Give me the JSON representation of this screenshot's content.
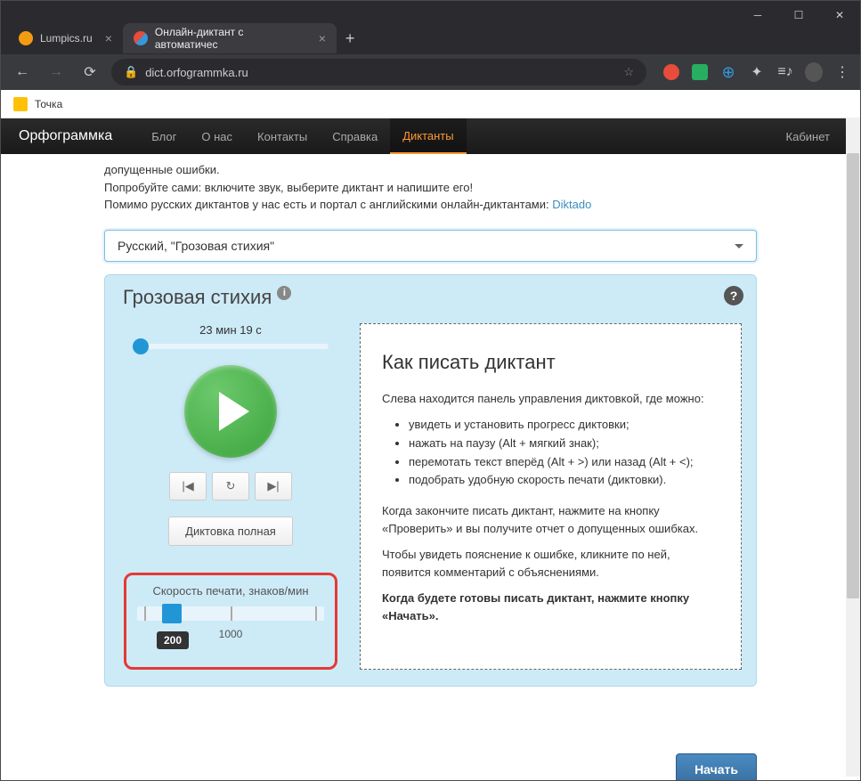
{
  "window": {
    "tabs": [
      {
        "title": "Lumpics.ru",
        "favicon_color": "#f39c12"
      },
      {
        "title": "Онлайн-диктант с автоматичес",
        "favicon_color": "#e74c3c"
      }
    ],
    "url_host": "dict.orfogrammka.ru",
    "bookmark": "Точка"
  },
  "site_nav": {
    "logo": "Орфограммка",
    "items": [
      "Блог",
      "О нас",
      "Контакты",
      "Справка",
      "Диктанты"
    ],
    "active_index": 4,
    "right": "Кабинет"
  },
  "intro": {
    "line0_cut": "допущенные ошибки.",
    "line1": "Попробуйте сами: включите звук, выберите диктант и напишите его!",
    "line2_pre": "Помимо русских диктантов у нас есть и портал с английскими онлайн-диктантами: ",
    "link": "Diktado"
  },
  "select_value": "Русский, \"Грозовая стихия\"",
  "panel": {
    "title": "Грозовая стихия",
    "duration": "23 мин 19 с",
    "mode_button": "Диктовка полная",
    "speed": {
      "label": "Скорость печати, знаков/мин",
      "current": "200",
      "max": "1000"
    }
  },
  "instructions": {
    "heading": "Как писать диктант",
    "p1": "Слева находится панель управления диктовкой, где можно:",
    "bullets": [
      "увидеть и установить прогресс диктовки;",
      "нажать на паузу (Alt + мягкий знак);",
      "перемотать текст вперёд (Alt + >) или назад (Alt + <);",
      "подобрать удобную скорость печати (диктовки)."
    ],
    "p2": "Когда закончите писать диктант, нажмите на кнопку «Проверить» и вы получите отчет о допущенных ошибках.",
    "p3": "Чтобы увидеть пояснение к ошибке, кликните по ней, появится комментарий с объяснениями.",
    "p4_strong": "Когда будете готовы писать диктант, нажмите кнопку «Начать».",
    "start_button": "Начать"
  }
}
